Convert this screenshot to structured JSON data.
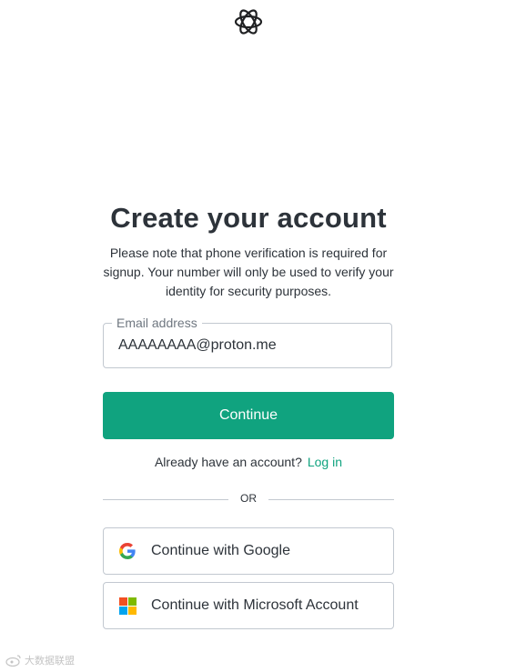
{
  "logo": {
    "icon": "openai-logo-icon"
  },
  "heading": {
    "title": "Create your account",
    "subtitle": "Please note that phone verification is required for signup. Your number will only be used to verify your identity for security purposes."
  },
  "email": {
    "label": "Email address",
    "value": "AAAAAAAA@proton.me"
  },
  "continue_button": {
    "label": "Continue",
    "color": "#10a37f"
  },
  "login": {
    "prompt": "Already have an account?",
    "link": "Log in"
  },
  "divider": {
    "label": "OR"
  },
  "social": [
    {
      "label": "Continue with Google",
      "icon": "google-icon"
    },
    {
      "label": "Continue with Microsoft Account",
      "icon": "microsoft-icon"
    }
  ],
  "watermark": {
    "text": "大数据联盟",
    "icon": "weibo-icon"
  }
}
